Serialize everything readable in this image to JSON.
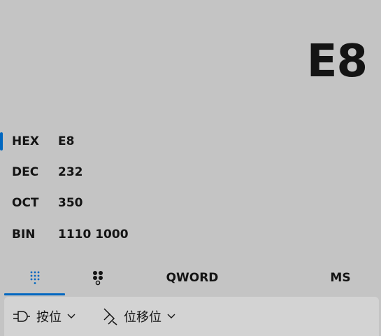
{
  "display": {
    "value": "E8"
  },
  "radix": [
    {
      "label": "HEX",
      "value": "E8",
      "selected": true
    },
    {
      "label": "DEC",
      "value": "232"
    },
    {
      "label": "OCT",
      "value": "350"
    },
    {
      "label": "BIN",
      "value": "1110 1000"
    }
  ],
  "tabs": {
    "keypad_icon": "dial-pad-icon",
    "bits_icon": "bit-toggle-icon",
    "word_size": "QWORD",
    "memory": "MS"
  },
  "toolbar": {
    "bitwise_label": "按位",
    "bitshift_label": "位移位"
  },
  "colors": {
    "accent": "#0067c0",
    "background": "#c4c4c4",
    "toolbar": "#d3d3d3"
  }
}
